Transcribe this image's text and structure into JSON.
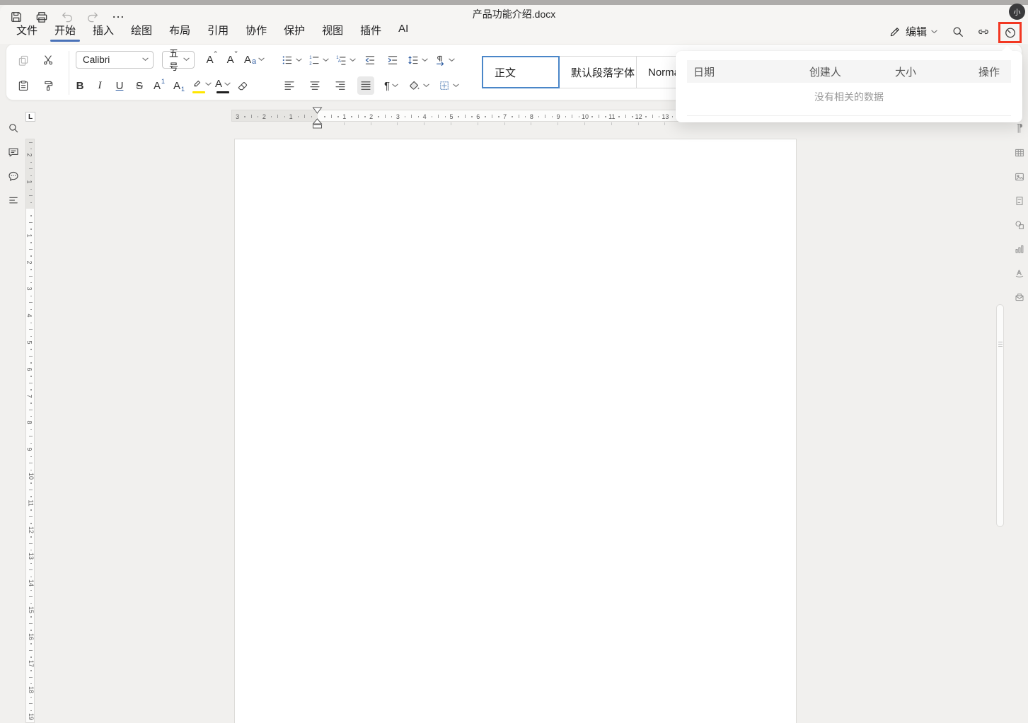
{
  "window": {
    "title": "产品功能介绍.docx",
    "avatar_text": "小"
  },
  "quick_actions": [
    {
      "name": "save-button",
      "icon": "save",
      "disabled": false
    },
    {
      "name": "print-button",
      "icon": "print",
      "disabled": false
    },
    {
      "name": "undo-button",
      "icon": "undo",
      "disabled": true
    },
    {
      "name": "redo-button",
      "icon": "redo",
      "disabled": true
    },
    {
      "name": "more-actions-button",
      "icon": "more",
      "disabled": false
    }
  ],
  "menu": {
    "tabs": [
      "文件",
      "开始",
      "插入",
      "绘图",
      "布局",
      "引用",
      "协作",
      "保护",
      "视图",
      "插件",
      "AI"
    ],
    "active_tab": "开始"
  },
  "top_right": {
    "edit_label": "编辑",
    "edit_icon": "pencil",
    "search_icon": "search",
    "link_icon": "link",
    "history_icon": "clock"
  },
  "toolbar": {
    "clipboard_row1": [
      {
        "name": "copy-button",
        "icon": "copy",
        "disabled": true
      },
      {
        "name": "cut-button",
        "icon": "cut"
      }
    ],
    "clipboard_row2": [
      {
        "name": "paste-button",
        "icon": "paste"
      },
      {
        "name": "format-painter-button",
        "icon": "painter"
      }
    ],
    "font_family": "Calibri",
    "font_size": "五号",
    "font_row1": [
      {
        "name": "grow-font-button",
        "glyph": "A",
        "mod": "ˆ",
        "modpos": "top"
      },
      {
        "name": "shrink-font-button",
        "glyph": "A",
        "mod": "ˇ",
        "modpos": "top"
      },
      {
        "name": "change-case-button",
        "glyph": "A",
        "mod": "a",
        "modpos": "base",
        "dropdown": true
      }
    ],
    "font_row2": [
      {
        "name": "bold-button",
        "glyph": "B",
        "cls": "g-b"
      },
      {
        "name": "italic-button",
        "glyph": "I",
        "cls": "g-i"
      },
      {
        "name": "underline-button",
        "glyph": "U",
        "cls": "g-u"
      },
      {
        "name": "strikethrough-button",
        "glyph": "S",
        "cls": "g-s"
      },
      {
        "name": "superscript-button",
        "glyph": "A",
        "mod": "1",
        "modpos": "sup"
      },
      {
        "name": "subscript-button",
        "glyph": "A",
        "mod": "1",
        "modpos": "sub"
      },
      {
        "name": "text-highlight-button",
        "icon": "highlight",
        "bar": "#ffe600",
        "dropdown": true
      },
      {
        "name": "font-color-button",
        "glyph": "A",
        "bar": "#1f1f1f",
        "dropdown": true
      },
      {
        "name": "clear-format-button",
        "icon": "eraser"
      }
    ],
    "para_row1": [
      {
        "name": "bullet-list-button",
        "icon": "bullets",
        "dropdown": true
      },
      {
        "name": "numbered-list-button",
        "icon": "numbered",
        "dropdown": true
      },
      {
        "name": "multilevel-list-button",
        "icon": "multilevel",
        "dropdown": true
      },
      {
        "name": "decrease-indent-button",
        "icon": "outdent"
      },
      {
        "name": "increase-indent-button",
        "icon": "indent"
      },
      {
        "name": "line-spacing-button",
        "icon": "linespacing",
        "dropdown": true
      },
      {
        "name": "paragraph-direction-button",
        "icon": "paradir",
        "dropdown": true
      }
    ],
    "para_row2": [
      {
        "name": "align-left-button",
        "icon": "align-left"
      },
      {
        "name": "align-center-button",
        "icon": "align-center"
      },
      {
        "name": "align-right-button",
        "icon": "align-right"
      },
      {
        "name": "justify-button",
        "icon": "justify",
        "selected": true
      },
      {
        "name": "show-marks-button",
        "glyph": "¶",
        "dropdown": true
      },
      {
        "name": "shading-button",
        "icon": "shading",
        "dropdown": true
      },
      {
        "name": "borders-button",
        "icon": "borders",
        "dropdown": true
      }
    ],
    "styles": [
      {
        "label": "正文",
        "selected": true
      },
      {
        "label": "默认段落字体",
        "selected": false
      },
      {
        "label": "Normal",
        "selected": false
      }
    ]
  },
  "history_panel": {
    "columns": [
      "日期",
      "创建人",
      "大小",
      "操作"
    ],
    "empty_text": "没有相关的数据"
  },
  "rulers": {
    "tab_selector": "L",
    "horizontal": {
      "margin_numbers": [
        3,
        2,
        1
      ],
      "page_numbers": [
        1,
        2,
        3,
        4,
        5,
        6,
        7,
        8,
        9,
        10,
        11,
        12,
        13
      ]
    },
    "vertical": {
      "margin_numbers": [
        2,
        1
      ],
      "page_numbers": [
        1,
        2,
        3,
        4,
        5,
        6,
        7,
        8,
        9,
        10,
        11,
        12,
        13,
        14,
        15,
        16,
        17,
        18,
        19
      ]
    }
  },
  "left_rail": [
    {
      "name": "find-icon",
      "icon": "search"
    },
    {
      "name": "comments-icon",
      "icon": "comment"
    },
    {
      "name": "chat-icon",
      "icon": "chat"
    },
    {
      "name": "outline-icon",
      "icon": "outline"
    }
  ],
  "right_rail": [
    {
      "name": "paragraph-mark-icon",
      "glyph": "¶"
    },
    {
      "name": "insert-table-icon",
      "icon": "table"
    },
    {
      "name": "insert-image-icon",
      "icon": "image"
    },
    {
      "name": "insert-textbox-icon",
      "icon": "textbox"
    },
    {
      "name": "insert-shape-icon",
      "icon": "shapes"
    },
    {
      "name": "insert-chart-icon",
      "icon": "chart"
    },
    {
      "name": "wordart-icon",
      "icon": "wordart"
    },
    {
      "name": "mail-icon",
      "icon": "mail"
    }
  ],
  "colors": {
    "accent_blue": "#4a72b8",
    "selection_blue": "#4a86c8",
    "highlight_yellow": "#ffe600",
    "font_color_black": "#1f1f1f",
    "red_box": "#f23722"
  }
}
